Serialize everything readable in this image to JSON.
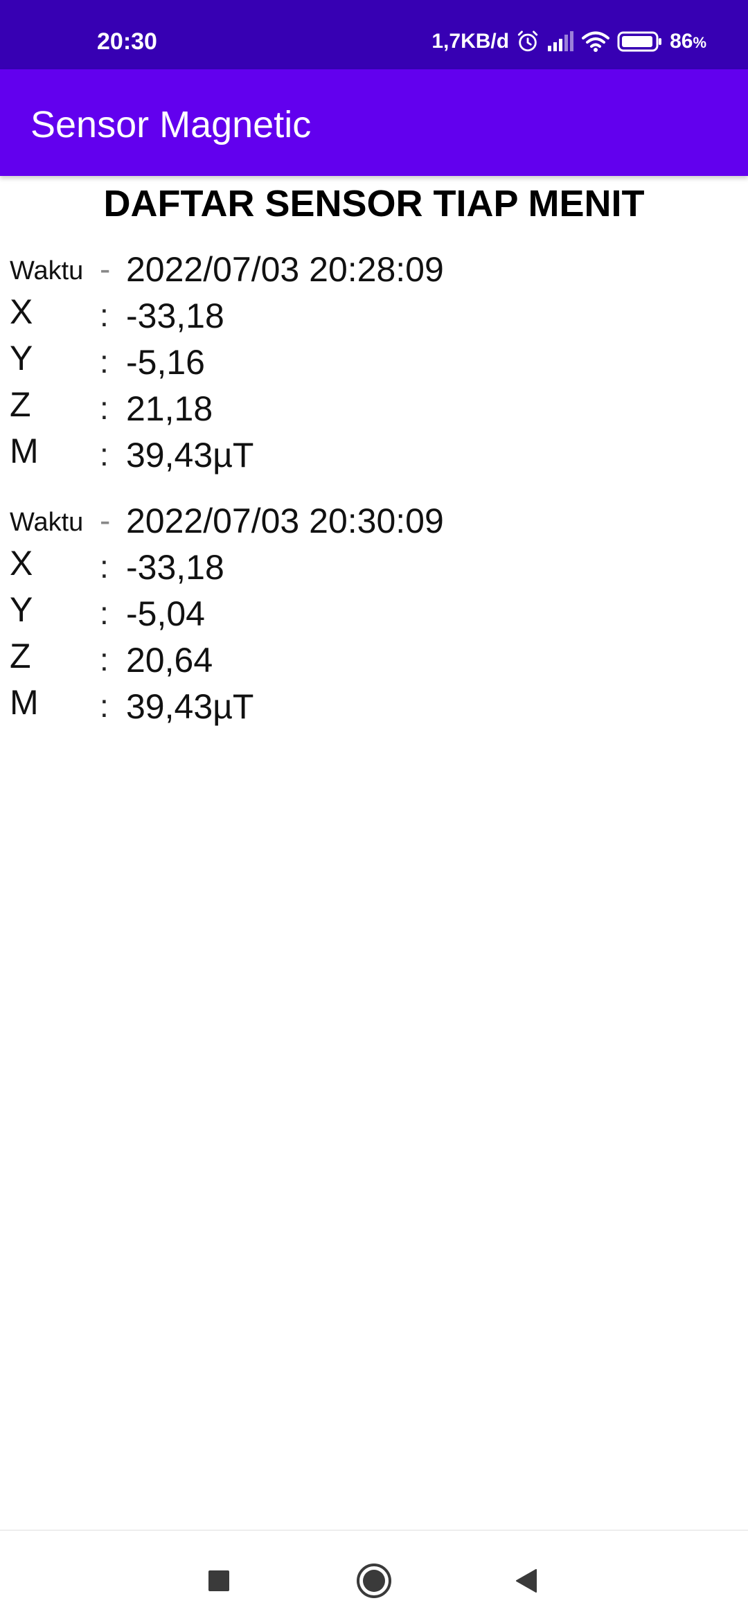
{
  "status_bar": {
    "time": "20:30",
    "network_speed": "1,7KB/d",
    "battery_percent": "86",
    "battery_unit": "%",
    "icons": [
      "alarm-icon",
      "signal-icon",
      "wifi-icon",
      "battery-icon"
    ]
  },
  "app_bar": {
    "title": "Sensor Magnetic",
    "color": "#6200ee"
  },
  "list": {
    "heading": "DAFTAR SENSOR TIAP MENIT",
    "records": [
      {
        "waktu_label": "Waktu",
        "waktu_sep": "-",
        "waktu": "2022/07/03 20:28:09",
        "x_label": "X",
        "x_sep": ":",
        "x": "-33,18",
        "y_label": "Y",
        "y_sep": ":",
        "y": "-5,16",
        "z_label": "Z",
        "z_sep": ":",
        "z": "21,18",
        "m_label": "M",
        "m_sep": ":",
        "m": "39,43µT"
      },
      {
        "waktu_label": "Waktu",
        "waktu_sep": "-",
        "waktu": "2022/07/03 20:30:09",
        "x_label": "X",
        "x_sep": ":",
        "x": "-33,18",
        "y_label": "Y",
        "y_sep": ":",
        "y": "-5,04",
        "z_label": "Z",
        "z_sep": ":",
        "z": "20,64",
        "m_label": "M",
        "m_sep": ":",
        "m": "39,43µT"
      }
    ]
  },
  "nav_bar": {
    "buttons": [
      "recents-icon",
      "home-icon",
      "back-icon"
    ]
  },
  "colors": {
    "status_bar": "#3700b3",
    "app_bar": "#6200ee",
    "text": "#111111"
  }
}
